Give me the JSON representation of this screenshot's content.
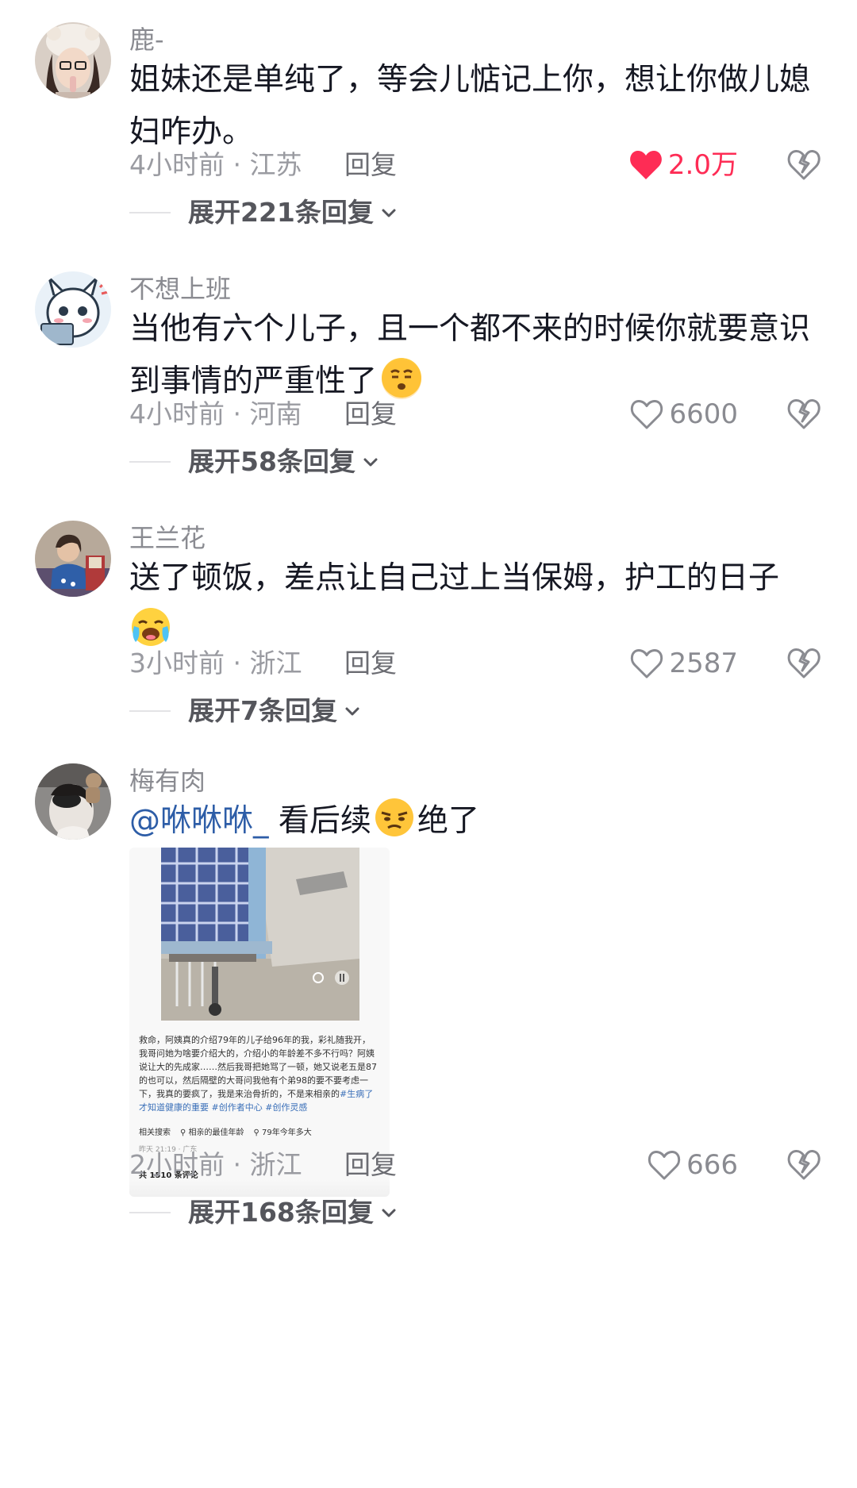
{
  "comments": [
    {
      "username": "鹿-",
      "text": "姐妹还是单纯了，等会儿惦记上你，想让你做儿媳妇咋办。",
      "meta": "4小时前 · 江苏",
      "reply_label": "回复",
      "likes": "2.0万",
      "liked": true,
      "expand_label": "展开221条回复"
    },
    {
      "username": "不想上班",
      "text": "当他有六个儿子，且一个都不来的时候你就要意识到事情的严重性了",
      "emoji": "smirk-face-emoji",
      "meta": "4小时前 · 河南",
      "reply_label": "回复",
      "likes": "6600",
      "liked": false,
      "expand_label": "展开58条回复"
    },
    {
      "username": "王兰花",
      "text": "送了顿饭，差点让自己过上当保姆，护工的日子",
      "emoji": "crying-face-emoji",
      "meta": "3小时前 · 浙江",
      "reply_label": "回复",
      "likes": "2587",
      "liked": false,
      "expand_label": "展开7条回复"
    },
    {
      "username": "梅有肉",
      "mention": "@咻咻咻_",
      "text_a": "看后续",
      "emoji": "annoyed-face-emoji",
      "text_b": "绝了",
      "meta": "2小时前 · 浙江",
      "reply_label": "回复",
      "likes": "666",
      "liked": false,
      "expand_label": "展开168条回复",
      "attachment": {
        "caption": "救命，阿姨真的介绍79年的儿子给96年的我，彩礼随我开，我哥问她为啥要介绍大的，介绍小的年龄差不多不行吗？阿姨说让大的先成家……然后我哥把她骂了一顿，她又说老五是87的也可以，然后隔壁的大哥问我他有个弟98的要不要考虑一下，我真的要疯了，我是来治骨折的，不是来相亲的",
        "tags": "#生病了才知道健康的重要 #创作者中心 #创作灵感",
        "chip_1": "相关搜索",
        "chip_2": "相亲的最佳年龄",
        "chip_3": "79年今年多大",
        "time": "昨天 21:19 · 广东",
        "comment_count": "共 1510 条评论"
      }
    }
  ],
  "colors": {
    "like_active": "#fe2c55",
    "mention": "#2d5da7",
    "secondary_text": "#9a9ba1"
  }
}
